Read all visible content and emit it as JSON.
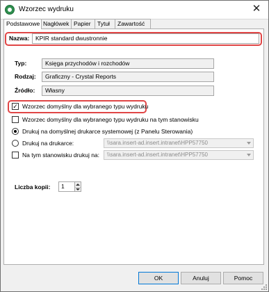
{
  "window": {
    "title": "Wzorzec wydruku",
    "close_glyph": "✕"
  },
  "tabs": [
    {
      "label": "Podstawowe",
      "active": true
    },
    {
      "label": "Nagłówek",
      "active": false
    },
    {
      "label": "Papier",
      "active": false
    },
    {
      "label": "Tytuł",
      "active": false
    },
    {
      "label": "Zawartość",
      "active": false
    }
  ],
  "form": {
    "nazwa": {
      "label": "Nazwa:",
      "value": "KPIR standard dwustronnie"
    },
    "typ": {
      "label": "Typ:",
      "value": "Księga przychodów i rozchodów"
    },
    "rodzaj": {
      "label": "Rodzaj:",
      "value": "Graficzny - Crystal Reports"
    },
    "zrodlo": {
      "label": "Źródło:",
      "value": "Własny"
    }
  },
  "options": {
    "default_pattern": {
      "label": "Wzorzec domyślny dla wybranego typu wydruku",
      "checked": true
    },
    "default_station": {
      "label": "Wzorzec domyślny dla wybranego typu wydruku na tym stanowisku",
      "checked": false
    },
    "print_default": {
      "label": "Drukuj na domyślnej drukarce systemowej (z Panelu Sterowania)",
      "selected": true
    },
    "print_on": {
      "label": "Drukuj na drukarce:",
      "value": "\\\\sara.insert-ad.insert.intranet\\HPP57750",
      "selected": false
    },
    "station_print": {
      "label": "Na tym stanowisku drukuj na:",
      "value": "\\\\sara.insert-ad.insert.intranet\\HPP57750",
      "checked": false
    }
  },
  "copies": {
    "label": "Liczba kopii:",
    "value": "1"
  },
  "buttons": {
    "ok": "OK",
    "cancel": "Anuluj",
    "help": "Pomoc"
  },
  "colors": {
    "highlight": "#e04646",
    "accent": "#0078d7",
    "app_icon": "#2f8f4f"
  },
  "icons": {
    "app": "app-icon",
    "close": "close-icon",
    "check": "check-icon",
    "dropdown": "chevron-down-icon"
  }
}
